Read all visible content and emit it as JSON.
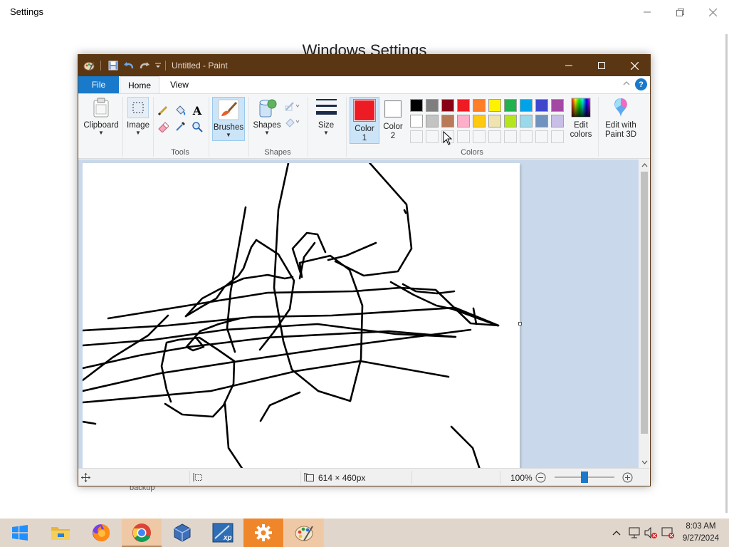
{
  "settings": {
    "title": "Settings",
    "heading": "Windows Settings",
    "backup_label": "backup"
  },
  "paint": {
    "window_title": "Untitled - Paint",
    "tabs": {
      "file": "File",
      "home": "Home",
      "view": "View"
    },
    "help": "?",
    "ribbon": {
      "clipboard": "Clipboard",
      "image": "Image",
      "tools_group": "Tools",
      "brushes": "Brushes",
      "shapes": "Shapes",
      "shapes_group": "Shapes",
      "size": "Size",
      "color1_line1": "Color",
      "color1_line2": "1",
      "color2_line1": "Color",
      "color2_line2": "2",
      "colors_group": "Colors",
      "edit_colors_line1": "Edit",
      "edit_colors_line2": "colors",
      "edit_paint3d_line1": "Edit with",
      "edit_paint3d_line2": "Paint 3D",
      "text_tool": "A"
    },
    "palette_row1": [
      "#000000",
      "#7f7f7f",
      "#880015",
      "#ed1c24",
      "#ff7f27",
      "#fff200",
      "#22b14c",
      "#00a2e8",
      "#3f48cc",
      "#a349a4"
    ],
    "palette_row2": [
      "#ffffff",
      "#c3c3c3",
      "#b97a57",
      "#ffaec9",
      "#ffc90e",
      "#efe4b0",
      "#b5e61d",
      "#99d9ea",
      "#7092be",
      "#c8bfe7"
    ],
    "color1": "#ed1c24",
    "color2": "#ffffff",
    "status": {
      "canvas_size": "614 × 460px",
      "zoom": "100%"
    }
  },
  "taskbar": {
    "time": "8:03 AM",
    "date": "9/27/2024"
  }
}
